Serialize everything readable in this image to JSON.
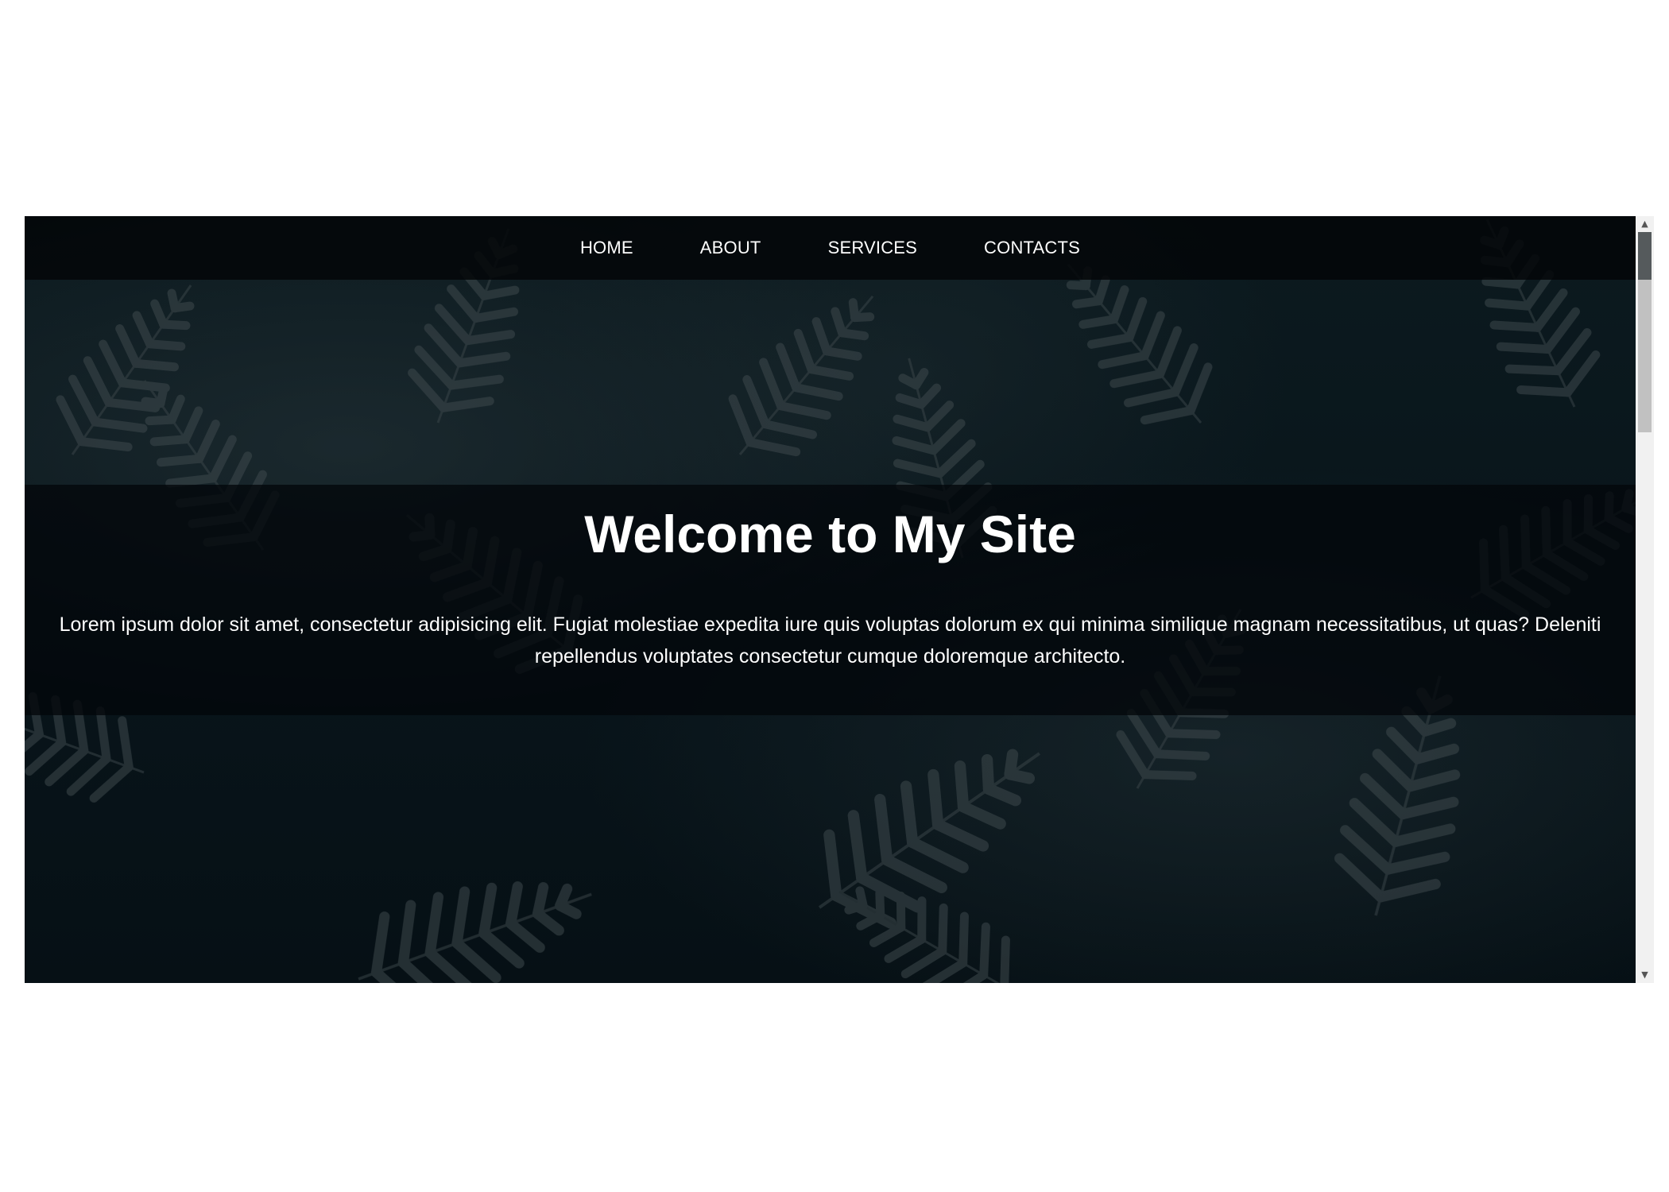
{
  "nav": {
    "items": [
      {
        "label": "HOME"
      },
      {
        "label": "ABOUT"
      },
      {
        "label": "SERVICES"
      },
      {
        "label": "CONTACTS"
      }
    ]
  },
  "hero": {
    "title": "Welcome to My Site",
    "text": "Lorem ipsum dolor sit amet, consectetur adipisicing elit. Fugiat molestiae expedita iure quis voluptas dolorum ex qui minima similique magnam necessitatibus, ut quas? Deleniti repellendus voluptates consectetur cumque doloremque architecto.",
    "background_image": "fern-leaves-icon"
  },
  "scrollbar": {
    "up_icon": "scroll-up-arrow-icon",
    "down_icon": "scroll-down-arrow-icon"
  },
  "colors": {
    "nav_background": "#030608",
    "hero_background": "#0b1519",
    "text": "#ffffff",
    "page_background": "#ffffff"
  }
}
